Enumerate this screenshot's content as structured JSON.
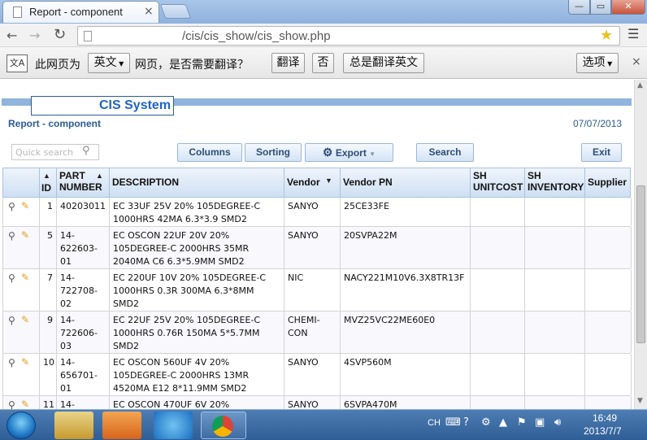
{
  "browser": {
    "tab_title": "Report - component",
    "tab_close": "×",
    "url": "/cis/cis_show/cis_show.php",
    "window_controls": {
      "min": "—",
      "max": "▭",
      "close": "✕"
    }
  },
  "translate_bar": {
    "prefix": "此网页为",
    "language": "英文",
    "middle": "网页，是否需要翻译？",
    "translate": "翻译",
    "no": "否",
    "always": "总是翻译英文",
    "options": "选项",
    "close": "×"
  },
  "app": {
    "title": "CIS System",
    "report_title": "Report - component",
    "date": "07/07/2013",
    "search_placeholder": "Quick search",
    "buttons": {
      "columns": "Columns",
      "sorting": "Sorting",
      "export": "Export",
      "search": "Search",
      "exit": "Exit"
    }
  },
  "table": {
    "columns": [
      {
        "l1": "",
        "l2": "ID"
      },
      {
        "l1": "PART",
        "l2": "NUMBER"
      },
      {
        "l1": "DESCRIPTION",
        "l2": ""
      },
      {
        "l1": "Vendor",
        "l2": ""
      },
      {
        "l1": "Vendor PN",
        "l2": ""
      },
      {
        "l1": "SH",
        "l2": "UNITCOST"
      },
      {
        "l1": "SH",
        "l2": "INVENTORY"
      },
      {
        "l1": "Supplier",
        "l2": ""
      }
    ],
    "rows": [
      {
        "id": "1",
        "part": [
          "40203011"
        ],
        "desc": [
          "EC 33UF 25V 20% 105DEGREE-C",
          "1000HRS 42MA 6.3*3.9 SMD2"
        ],
        "vendor": [
          "SANYO"
        ],
        "pn": "25CE33FE"
      },
      {
        "id": "5",
        "part": [
          "14-",
          "622603-",
          "01"
        ],
        "desc": [
          "EC OSCON 22UF 20V 20%",
          "105DEGREE-C 2000HRS 35MR",
          "2040MA C6 6.3*5.9MM SMD2"
        ],
        "vendor": [
          "SANYO"
        ],
        "pn": "20SVPA22M"
      },
      {
        "id": "7",
        "part": [
          "14-",
          "722708-",
          "02"
        ],
        "desc": [
          "EC 220UF 10V 20% 105DEGREE-C",
          "1000HRS 0.3R 300MA 6.3*8MM",
          "SMD2"
        ],
        "vendor": [
          "NIC"
        ],
        "pn": "NACY221M10V6.3X8TR13F"
      },
      {
        "id": "9",
        "part": [
          "14-",
          "722606-",
          "03"
        ],
        "desc": [
          "EC 22UF 25V 20% 105DEGREE-C",
          "1000HRS 0.76R 150MA 5*5.7MM",
          "SMD2"
        ],
        "vendor": [
          "CHEMI-",
          "CON"
        ],
        "pn": "MVZ25VC22ME60E0"
      },
      {
        "id": "10",
        "part": [
          "14-",
          "656701-",
          "01"
        ],
        "desc": [
          "EC OSCON 560UF 4V 20%",
          "105DEGREE-C 2000HRS 13MR",
          "4520MA E12 8*11.9MM SMD2"
        ],
        "vendor": [
          "SANYO"
        ],
        "pn": "4SVP560M"
      },
      {
        "id": "11",
        "part": [
          "14-"
        ],
        "desc": [
          "EC OSCON 470UF 6V 20%"
        ],
        "vendor": [
          "SANYO"
        ],
        "pn": "6SVPA470M"
      }
    ]
  },
  "taskbar": {
    "lang": "CH",
    "time": "16:49",
    "date": "2013/7/7"
  }
}
